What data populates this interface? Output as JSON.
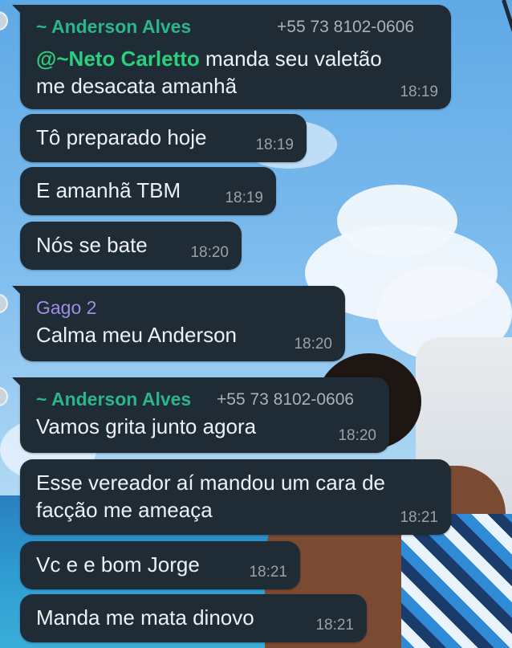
{
  "messages": [
    {
      "sender": "~ Anderson Alves",
      "phone": "+55 73 8102-0606",
      "mention": "@~Neto Carletto",
      "text": " manda seu valetão",
      "text2": "me desacata amanhã",
      "time": "18:19"
    },
    {
      "text": "Tô preparado hoje",
      "time": "18:19"
    },
    {
      "text": "E amanhã TBM",
      "time": "18:19"
    },
    {
      "text": "Nós se bate",
      "time": "18:20"
    },
    {
      "sender": "Gago 2",
      "text": "Calma meu Anderson",
      "time": "18:20"
    },
    {
      "sender": "~ Anderson Alves",
      "phone": "+55 73 8102-0606",
      "text": "Vamos grita junto agora",
      "time": "18:20"
    },
    {
      "text": "Esse vereador aí mandou um cara de",
      "text2": "facção me ameaça",
      "time": "18:21"
    },
    {
      "text": "Vc e e bom Jorge",
      "time": "18:21"
    },
    {
      "text": "Manda me mata dinovo",
      "time": "18:21"
    }
  ],
  "colors": {
    "bubble": "#1f2b35",
    "sender_green": "#2bb58a",
    "mention": "#2bd07f",
    "sender_purple": "#9f8ee8"
  }
}
